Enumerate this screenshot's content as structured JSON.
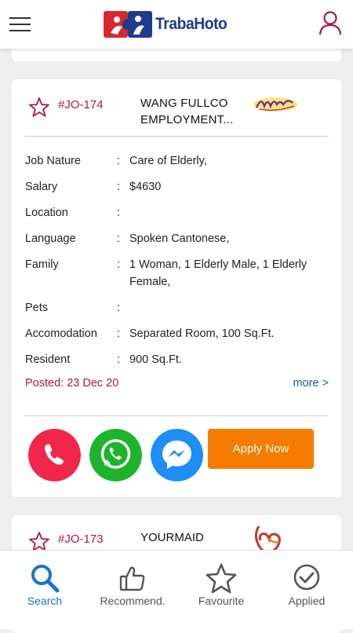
{
  "header": {
    "app_name": "TrabaHoto",
    "menu_icon": "hamburger-menu-icon",
    "user_icon": "user-profile-icon",
    "accent_color": "#b0183c"
  },
  "job_card": {
    "job_id": "#JO-174",
    "company_name": "WANG FULLCO EMPLOYMENT...",
    "details": [
      {
        "label": "Job Nature",
        "value": "Care of Elderly,"
      },
      {
        "label": "Salary",
        "value": "$4630"
      },
      {
        "label": "Location",
        "value": ""
      },
      {
        "label": "Language",
        "value": "Spoken Cantonese,"
      },
      {
        "label": "Family",
        "value": "1 Woman, 1 Elderly Male, 1 Elderly Female,"
      },
      {
        "label": "Pets",
        "value": ""
      },
      {
        "label": "Accomodation",
        "value": "Separated Room, 100 Sq.Ft."
      },
      {
        "label": "Resident",
        "value": "900 Sq.Ft."
      }
    ],
    "posted": "Posted: 23 Dec 20",
    "more_link": "more >",
    "apply_label": "Apply Now",
    "apply_color": "#f57c00"
  },
  "next_card": {
    "job_id": "#JO-173",
    "company_name": "YOURMAID"
  },
  "bottom_nav": {
    "items": [
      {
        "label": "Search",
        "icon": "search-icon",
        "active": true
      },
      {
        "label": "Recommend.",
        "icon": "thumbs-up-icon",
        "active": false
      },
      {
        "label": "Favourite",
        "icon": "star-icon",
        "active": false
      },
      {
        "label": "Applied",
        "icon": "check-circle-icon",
        "active": false
      }
    ]
  }
}
